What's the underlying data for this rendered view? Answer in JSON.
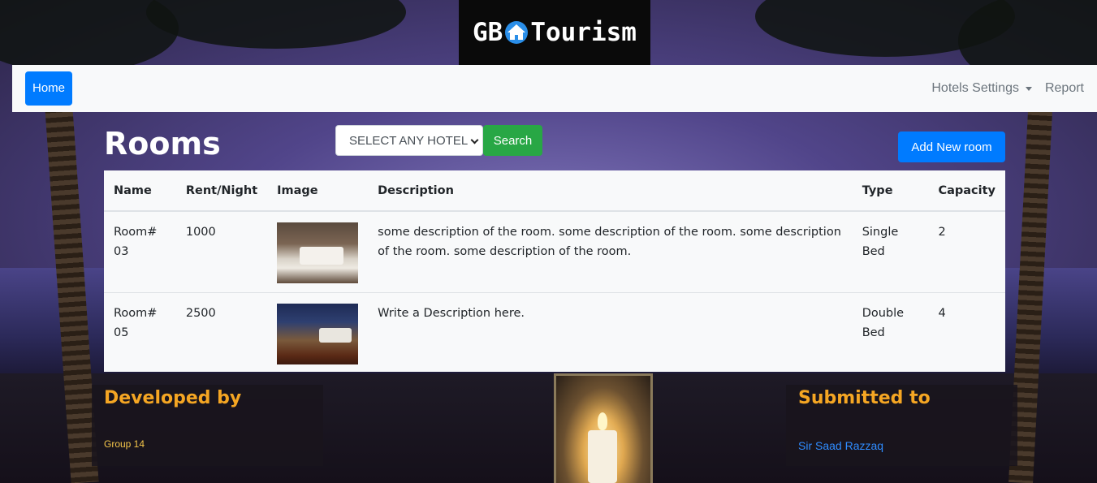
{
  "logo": {
    "text_left": "GB",
    "text_right": "Tourism",
    "house_icon": "house-icon"
  },
  "navbar": {
    "home_label": "Home",
    "hotels_settings_label": "Hotels Settings",
    "report_label": "Report"
  },
  "page": {
    "title": "Rooms",
    "hotel_select": {
      "selected": "SELECT ANY HOTEL"
    },
    "search_label": "Search",
    "add_room_label": "Add New room"
  },
  "table": {
    "headers": {
      "name": "Name",
      "rent": "Rent/Night",
      "image": "Image",
      "description": "Description",
      "type": "Type",
      "capacity": "Capacity"
    },
    "rows": [
      {
        "name": "Room# 03",
        "rent": "1000",
        "image": "room-03-photo",
        "description": "some description of the room. some description of the room. some description of the room. some description of the room.",
        "type": "Single Bed",
        "capacity": "2"
      },
      {
        "name": "Room# 05",
        "rent": "2500",
        "image": "room-05-photo",
        "description": "Write a Description here.",
        "type": "Double Bed",
        "capacity": "4"
      }
    ]
  },
  "footer": {
    "developed_heading": "Developed by",
    "developed_value": "Group 14",
    "submitted_heading": "Submitted to",
    "submitted_value": "Sir Saad Razzaq"
  },
  "colors": {
    "primary": "#007bff",
    "success": "#28a745",
    "footer_heading": "#f5a623",
    "link": "#2f8cff"
  }
}
